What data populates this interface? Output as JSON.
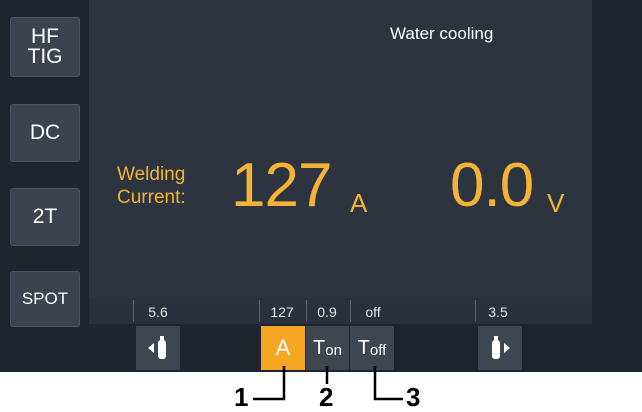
{
  "side_buttons": [
    {
      "line1": "HF",
      "line2": "TIG"
    },
    {
      "line1": "DC",
      "line2": ""
    },
    {
      "line1": "2T",
      "line2": ""
    },
    {
      "line1": "SPOT",
      "line2": ""
    }
  ],
  "header": {
    "status": "Water cooling"
  },
  "main": {
    "label_line1": "Welding",
    "label_line2": "Current:",
    "current_value": "127",
    "current_unit": "A",
    "voltage_value": "0.0",
    "voltage_unit": "V"
  },
  "param_values": {
    "pre_gas": "5.6",
    "current": "127",
    "t_on": "0.9",
    "t_off": "off",
    "post_gas": "3.5"
  },
  "param_buttons": {
    "current_label": "A",
    "t_on_base": "T",
    "t_on_sub": "on",
    "t_off_base": "T",
    "t_off_sub": "off"
  },
  "callouts": [
    "1",
    "2",
    "3"
  ],
  "colors": {
    "accent": "#f5a623",
    "panel": "#2c3440",
    "background": "#1f252e"
  }
}
